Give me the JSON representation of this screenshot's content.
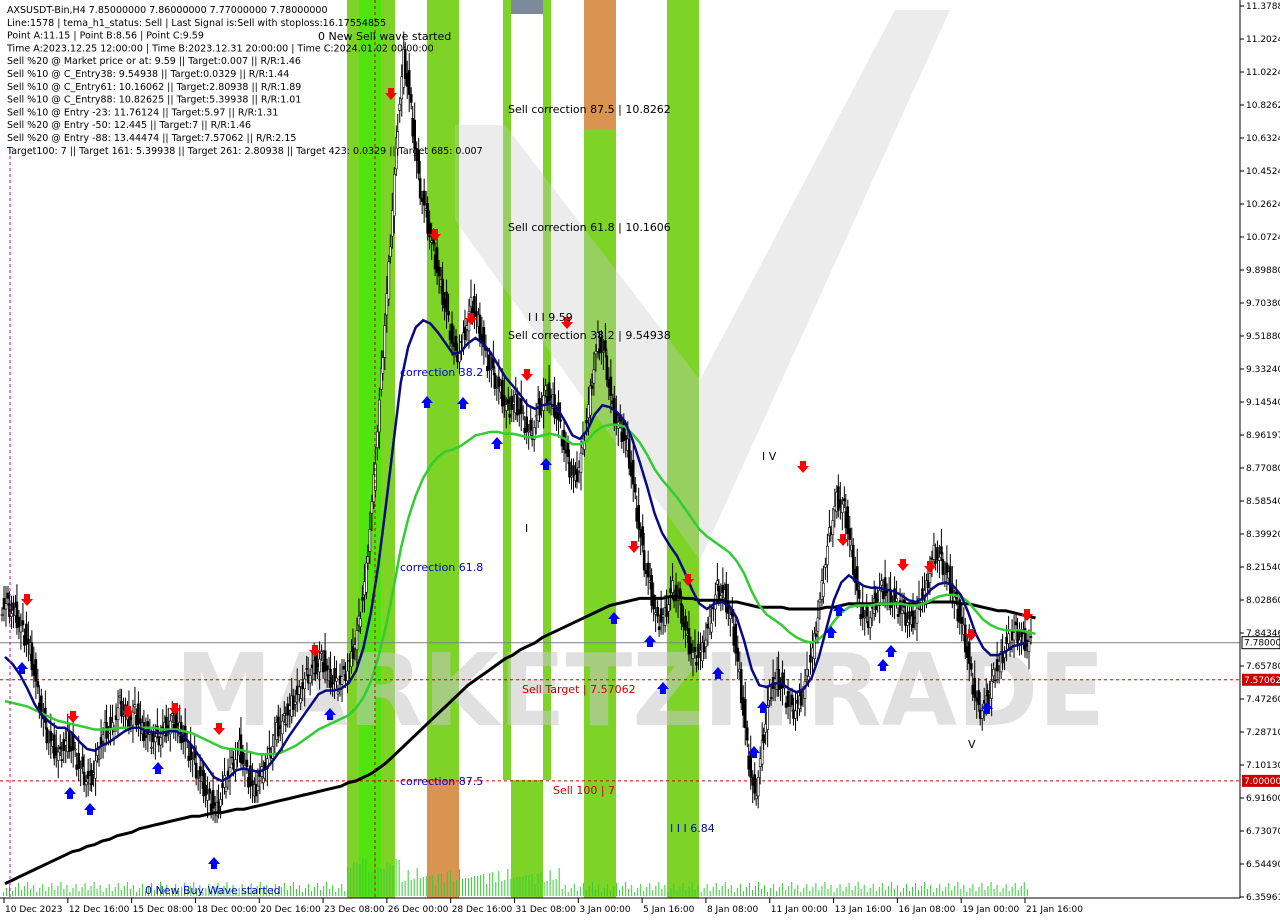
{
  "header": {
    "lines": [
      "AXSUSDT-Bin,H4  7.85000000 7.86000000 7.77000000 7.78000000",
      "Line:1578 | tema_h1_status: Sell | Last Signal is:Sell with stoploss:16.17554855",
      "Point A:11.15 | Point B:8.56 | Point C:9.59",
      "Time A:2023.12.25 12:00:00 | Time B:2023.12.31 20:00:00 | Time C:2024.01.02 00:00:00",
      "Sell %20 @ Market price or at: 9.59 || Target:0.007 || R/R:1.46",
      "Sell %10 @ C_Entry38: 9.54938 || Target:0.0329 || R/R:1.44",
      "Sell %10 @ C_Entry61: 10.16062 || Target:2.80938 || R/R:1.89",
      "Sell %10 @ C_Entry88: 10.82625 || Target:5.39938 || R/R:1.01",
      "Sell %10 @ Entry -23: 11.76124 || Target:5.97 || R/R:1.31",
      "Sell %20 @ Entry -50: 12.445 || Target:7 || R/R:1.46",
      "Sell %20 @ Entry -88: 13.44474 || Target:7.57062 || R/R:2.15",
      "Target100: 7 || Target 161: 5.39938 || Target 261: 2.80938 || Target 423: 0.0329 || Target 685: 0.007"
    ]
  },
  "colors": {
    "zone_green": "#66cc00",
    "zone_bright_green": "#33ee00",
    "zone_orange": "#d89450",
    "ma_fast": "#0a0a80",
    "ma_mid": "#33cc33",
    "ma_slow": "#000000",
    "arrow_up": "#0000ff",
    "arrow_down": "#ff0000",
    "volume": "#33cc33",
    "price_line": "#7f7f7f",
    "level_line": "#cc0000",
    "watermark": "#c8c8c8"
  },
  "annotations": {
    "new_sell": "0 New Sell wave started",
    "new_buy": "0 New Buy Wave started",
    "sell_corr_875": "Sell correction 87.5 | 10.8262",
    "sell_corr_618": "Sell correction 61.8 | 10.1606",
    "sell_corr_382": "Sell correction 38.2 | 9.54938",
    "corr_382": "correction 38.2",
    "corr_618": "correction 61.8",
    "corr_875": "correction 87.5",
    "sell_target": "Sell Target | 7.57062",
    "sell_100": "Sell 100 | 7",
    "wave_iii_top": "I I I 9.59",
    "wave_iii_bottom": "I I I 6.84",
    "wave_iv": "I V",
    "wave_v": "V",
    "wave_i": "I",
    "watermark_text": "MARKETZITRADE"
  },
  "chart_data": {
    "type": "candlestick",
    "symbol": "AXSUSDT-Bin",
    "timeframe": "H4",
    "ohlc_last": {
      "open": 7.85,
      "high": 7.86,
      "low": 7.77,
      "close": 7.78
    },
    "ylim": [
      6.35,
      11.38
    ],
    "y_ticks": [
      "11.37880",
      "11.20240",
      "11.02240",
      "10.82625",
      "10.63240",
      "10.45240",
      "10.26240",
      "10.07240",
      "9.89880",
      "9.70380",
      "9.51880",
      "9.33240",
      "9.14540",
      "8.96197",
      "8.77080",
      "8.58540",
      "8.39920",
      "8.21540",
      "8.02860",
      "7.84346",
      "7.65780",
      "7.47260",
      "7.28710",
      "7.10130",
      "6.91600",
      "6.73070",
      "6.54490",
      "6.35961"
    ],
    "x_ticks": [
      "10 Dec 2023",
      "12 Dec 16:00",
      "15 Dec 08:00",
      "18 Dec 00:00",
      "20 Dec 16:00",
      "23 Dec 08:00",
      "26 Dec 00:00",
      "28 Dec 16:00",
      "31 Dec 08:00",
      "3 Jan 00:00",
      "5 Jan 16:00",
      "8 Jan 08:00",
      "11 Jan 00:00",
      "13 Jan 16:00",
      "16 Jan 08:00",
      "19 Jan 00:00",
      "21 Jan 16:00"
    ],
    "price_labels": {
      "current": "7.78000",
      "sell_target": "7.57062",
      "sell_100": "7.00000"
    },
    "levels": {
      "current": 7.78,
      "sell_target": 7.57062,
      "sell_100": 7.0
    },
    "close_series": [
      8.0,
      7.95,
      7.85,
      7.75,
      7.5,
      7.3,
      7.2,
      7.15,
      7.25,
      7.15,
      7.05,
      7.0,
      7.15,
      7.3,
      7.3,
      7.45,
      7.35,
      7.4,
      7.3,
      7.25,
      7.25,
      7.3,
      7.35,
      7.3,
      7.2,
      7.1,
      7.0,
      6.9,
      6.85,
      7.0,
      7.1,
      7.2,
      7.05,
      6.95,
      7.05,
      7.15,
      7.3,
      7.35,
      7.45,
      7.5,
      7.6,
      7.65,
      7.7,
      7.6,
      7.55,
      7.6,
      7.7,
      7.9,
      8.2,
      8.7,
      9.3,
      9.9,
      10.6,
      11.1,
      10.8,
      10.4,
      10.2,
      10.0,
      9.8,
      9.6,
      9.4,
      9.5,
      9.7,
      9.6,
      9.4,
      9.3,
      9.2,
      9.1,
      9.15,
      9.05,
      8.95,
      9.1,
      9.2,
      9.15,
      9.0,
      8.8,
      8.7,
      8.9,
      9.2,
      9.5,
      9.4,
      9.1,
      9.0,
      8.9,
      8.6,
      8.3,
      8.1,
      7.9,
      7.95,
      8.1,
      8.0,
      7.8,
      7.7,
      7.75,
      7.9,
      8.1,
      8.05,
      7.9,
      7.6,
      7.2,
      6.9,
      7.2,
      7.5,
      7.6,
      7.5,
      7.4,
      7.45,
      7.6,
      7.8,
      8.1,
      8.4,
      8.6,
      8.55,
      8.3,
      8.0,
      7.9,
      8.0,
      8.1,
      8.05,
      8.0,
      7.95,
      7.9,
      8.0,
      8.1,
      8.3,
      8.25,
      8.15,
      8.0,
      7.85,
      7.6,
      7.4,
      7.45,
      7.6,
      7.7,
      7.8,
      7.85,
      7.8,
      7.78
    ],
    "ma_fast_series": [
      7.7,
      7.66,
      7.6,
      7.52,
      7.43,
      7.37,
      7.33,
      7.3,
      7.3,
      7.27,
      7.22,
      7.18,
      7.17,
      7.2,
      7.22,
      7.25,
      7.28,
      7.3,
      7.3,
      7.28,
      7.27,
      7.27,
      7.28,
      7.28,
      7.25,
      7.2,
      7.14,
      7.08,
      7.02,
      7.0,
      7.02,
      7.06,
      7.07,
      7.06,
      7.05,
      7.07,
      7.12,
      7.18,
      7.25,
      7.31,
      7.37,
      7.43,
      7.49,
      7.51,
      7.51,
      7.52,
      7.55,
      7.62,
      7.75,
      7.95,
      8.22,
      8.55,
      8.9,
      9.25,
      9.45,
      9.56,
      9.6,
      9.58,
      9.53,
      9.47,
      9.41,
      9.42,
      9.47,
      9.5,
      9.47,
      9.42,
      9.35,
      9.28,
      9.23,
      9.18,
      9.12,
      9.1,
      9.12,
      9.13,
      9.1,
      9.03,
      8.95,
      8.93,
      8.98,
      9.07,
      9.12,
      9.11,
      9.08,
      9.03,
      8.93,
      8.8,
      8.66,
      8.51,
      8.4,
      8.33,
      8.27,
      8.18,
      8.08,
      8.0,
      7.97,
      8.0,
      8.01,
      7.99,
      7.92,
      7.79,
      7.63,
      7.54,
      7.53,
      7.55,
      7.55,
      7.52,
      7.5,
      7.52,
      7.58,
      7.7,
      7.86,
      8.02,
      8.12,
      8.16,
      8.13,
      8.1,
      8.09,
      8.09,
      8.08,
      8.07,
      8.05,
      8.02,
      8.01,
      8.03,
      8.08,
      8.11,
      8.12,
      8.1,
      8.05,
      7.95,
      7.83,
      7.75,
      7.71,
      7.71,
      7.73,
      7.76,
      7.77,
      7.78
    ],
    "ma_mid_series": [
      7.45,
      7.44,
      7.43,
      7.42,
      7.4,
      7.38,
      7.36,
      7.34,
      7.33,
      7.32,
      7.31,
      7.3,
      7.29,
      7.29,
      7.29,
      7.3,
      7.3,
      7.3,
      7.3,
      7.3,
      7.3,
      7.29,
      7.29,
      7.29,
      7.28,
      7.27,
      7.25,
      7.23,
      7.21,
      7.19,
      7.18,
      7.18,
      7.17,
      7.16,
      7.15,
      7.15,
      7.15,
      7.16,
      7.18,
      7.2,
      7.23,
      7.26,
      7.29,
      7.31,
      7.33,
      7.35,
      7.37,
      7.41,
      7.47,
      7.56,
      7.7,
      7.87,
      8.08,
      8.31,
      8.48,
      8.61,
      8.71,
      8.78,
      8.83,
      8.86,
      8.87,
      8.89,
      8.92,
      8.95,
      8.96,
      8.97,
      8.97,
      8.96,
      8.96,
      8.95,
      8.94,
      8.94,
      8.95,
      8.96,
      8.95,
      8.93,
      8.9,
      8.9,
      8.92,
      8.97,
      9.0,
      9.01,
      9.01,
      9.0,
      8.96,
      8.91,
      8.84,
      8.76,
      8.7,
      8.65,
      8.6,
      8.54,
      8.48,
      8.42,
      8.38,
      8.35,
      8.32,
      8.29,
      8.24,
      8.17,
      8.07,
      7.99,
      7.94,
      7.91,
      7.88,
      7.84,
      7.81,
      7.79,
      7.78,
      7.8,
      7.84,
      7.9,
      7.95,
      7.98,
      7.99,
      7.99,
      7.99,
      8.0,
      8.0,
      8.0,
      8.0,
      7.99,
      7.99,
      8.0,
      8.02,
      8.04,
      8.05,
      8.05,
      8.04,
      8.01,
      7.96,
      7.91,
      7.88,
      7.86,
      7.85,
      7.85,
      7.85,
      7.84,
      7.83
    ],
    "ma_slow_series": [
      6.42,
      6.44,
      6.46,
      6.48,
      6.5,
      6.52,
      6.54,
      6.56,
      6.58,
      6.6,
      6.61,
      6.63,
      6.64,
      6.66,
      6.67,
      6.69,
      6.7,
      6.71,
      6.73,
      6.74,
      6.75,
      6.76,
      6.77,
      6.78,
      6.79,
      6.8,
      6.8,
      6.81,
      6.82,
      6.82,
      6.83,
      6.84,
      6.84,
      6.85,
      6.86,
      6.87,
      6.88,
      6.89,
      6.9,
      6.91,
      6.92,
      6.93,
      6.94,
      6.95,
      6.96,
      6.97,
      6.99,
      7.0,
      7.02,
      7.04,
      7.07,
      7.1,
      7.14,
      7.18,
      7.22,
      7.26,
      7.3,
      7.34,
      7.38,
      7.42,
      7.46,
      7.5,
      7.54,
      7.57,
      7.6,
      7.63,
      7.66,
      7.69,
      7.71,
      7.74,
      7.76,
      7.78,
      7.81,
      7.83,
      7.85,
      7.87,
      7.89,
      7.91,
      7.93,
      7.95,
      7.97,
      7.99,
      8.0,
      8.01,
      8.02,
      8.03,
      8.03,
      8.03,
      8.03,
      8.04,
      8.04,
      8.03,
      8.03,
      8.02,
      8.02,
      8.02,
      8.02,
      8.01,
      8.01,
      8.0,
      7.99,
      7.98,
      7.98,
      7.98,
      7.98,
      7.97,
      7.97,
      7.97,
      7.97,
      7.97,
      7.98,
      7.98,
      7.99,
      8.0,
      8.0,
      8.0,
      8.0,
      8.0,
      8.0,
      8.0,
      8.0,
      8.0,
      8.0,
      8.0,
      8.01,
      8.01,
      8.01,
      8.01,
      8.0,
      8.0,
      7.99,
      7.98,
      7.97,
      7.96,
      7.96,
      7.95,
      7.94,
      7.93,
      7.92
    ]
  }
}
